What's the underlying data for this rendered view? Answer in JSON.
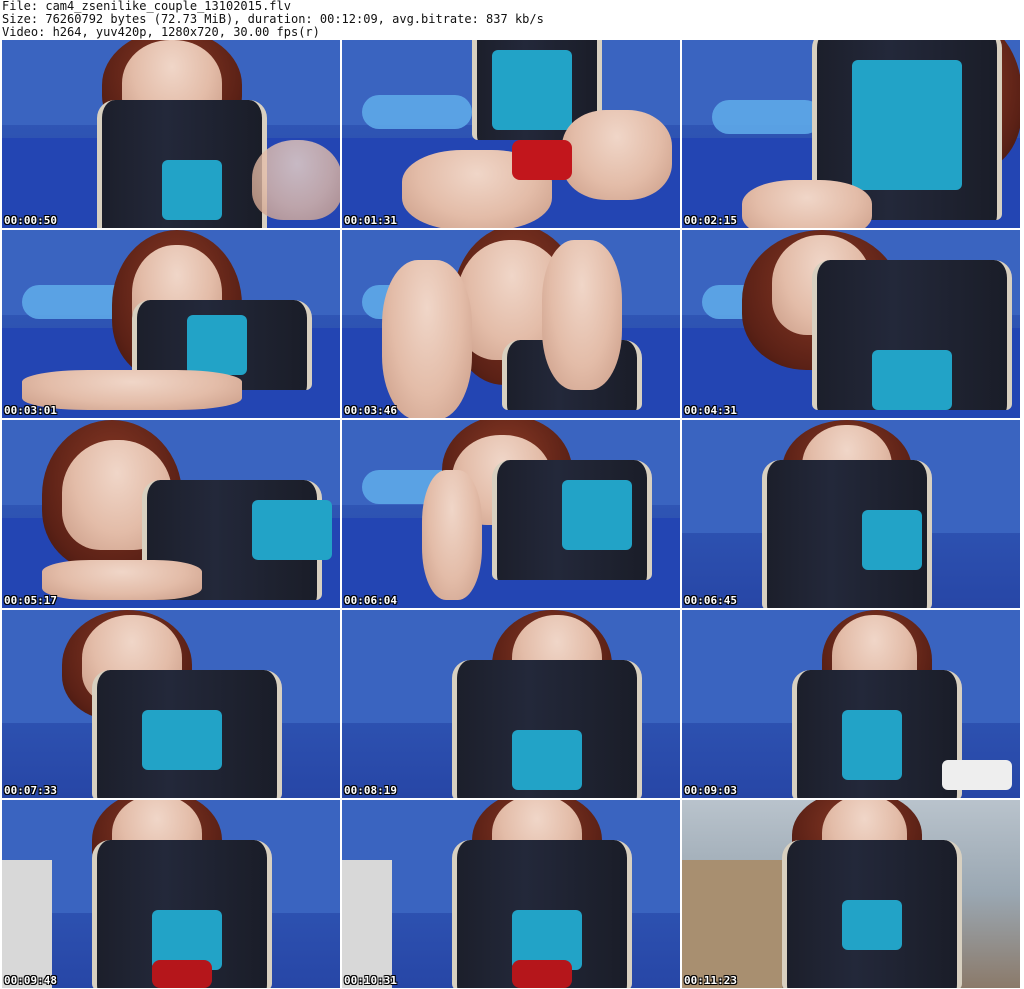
{
  "header": {
    "file_line": "File: cam4_zsenilike_couple_13102015.flv",
    "size_line": "Size: 76260792 bytes (72.73 MiB), duration: 00:12:09, avg.bitrate: 837 kb/s",
    "video_line": "Video: h264, yuv420p, 1280x720, 30.00 fps(r)"
  },
  "thumbnails": [
    {
      "timestamp": "00:00:50"
    },
    {
      "timestamp": "00:01:31"
    },
    {
      "timestamp": "00:02:15"
    },
    {
      "timestamp": "00:03:01"
    },
    {
      "timestamp": "00:03:46"
    },
    {
      "timestamp": "00:04:31"
    },
    {
      "timestamp": "00:05:17"
    },
    {
      "timestamp": "00:06:04"
    },
    {
      "timestamp": "00:06:45"
    },
    {
      "timestamp": "00:07:33"
    },
    {
      "timestamp": "00:08:19"
    },
    {
      "timestamp": "00:09:03"
    },
    {
      "timestamp": "00:09:48"
    },
    {
      "timestamp": "00:10:31"
    },
    {
      "timestamp": "00:11:23"
    }
  ]
}
